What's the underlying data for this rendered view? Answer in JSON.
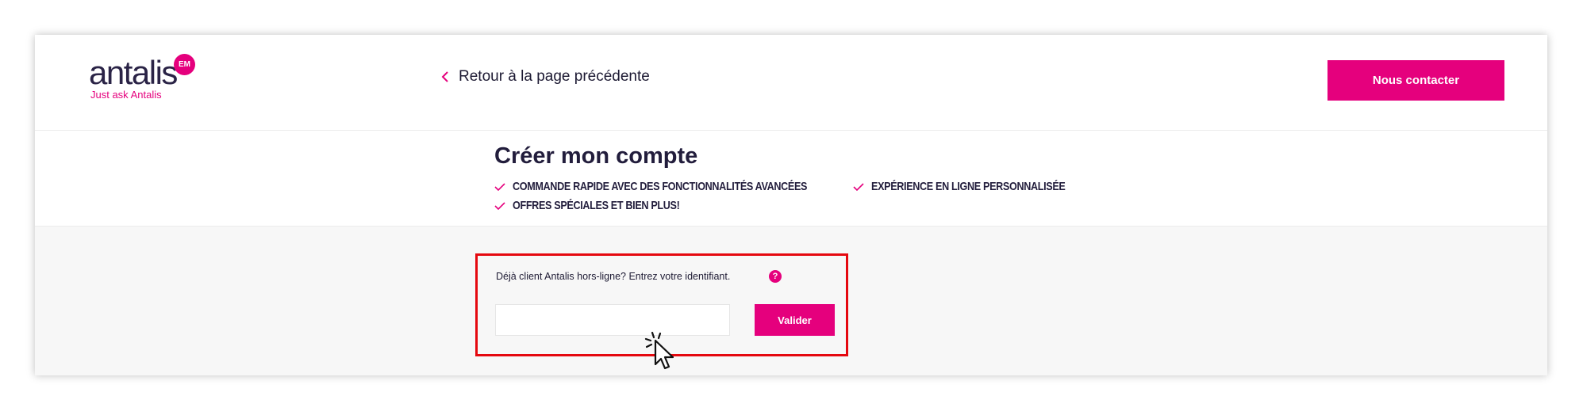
{
  "header": {
    "logo": {
      "wordmark": "antalis",
      "badge": "EM",
      "tagline": "Just ask Antalis"
    },
    "back_link": {
      "label": "Retour à la page précédente",
      "icon": "chevron-left-icon"
    },
    "contact_button": "Nous contacter"
  },
  "hero": {
    "title": "Créer mon compte",
    "features": [
      "COMMANDE RAPIDE AVEC DES FONCTIONNALITÉS AVANCÉES",
      "EXPÉRIENCE EN LIGNE PERSONNALISÉE",
      "OFFRES SPÉCIALES ET BIEN PLUS!"
    ],
    "feature_icon": "checkmark-icon"
  },
  "login_form": {
    "prompt": "Déjà client Antalis hors-ligne? Entrez votre identifiant.",
    "help_icon": "?",
    "identifier_value": "",
    "identifier_placeholder": "",
    "submit_label": "Valider"
  },
  "colors": {
    "brand": "#e5007d",
    "text_dark": "#221d3c",
    "highlight": "#e5080f",
    "form_background": "#f7f7f7"
  }
}
